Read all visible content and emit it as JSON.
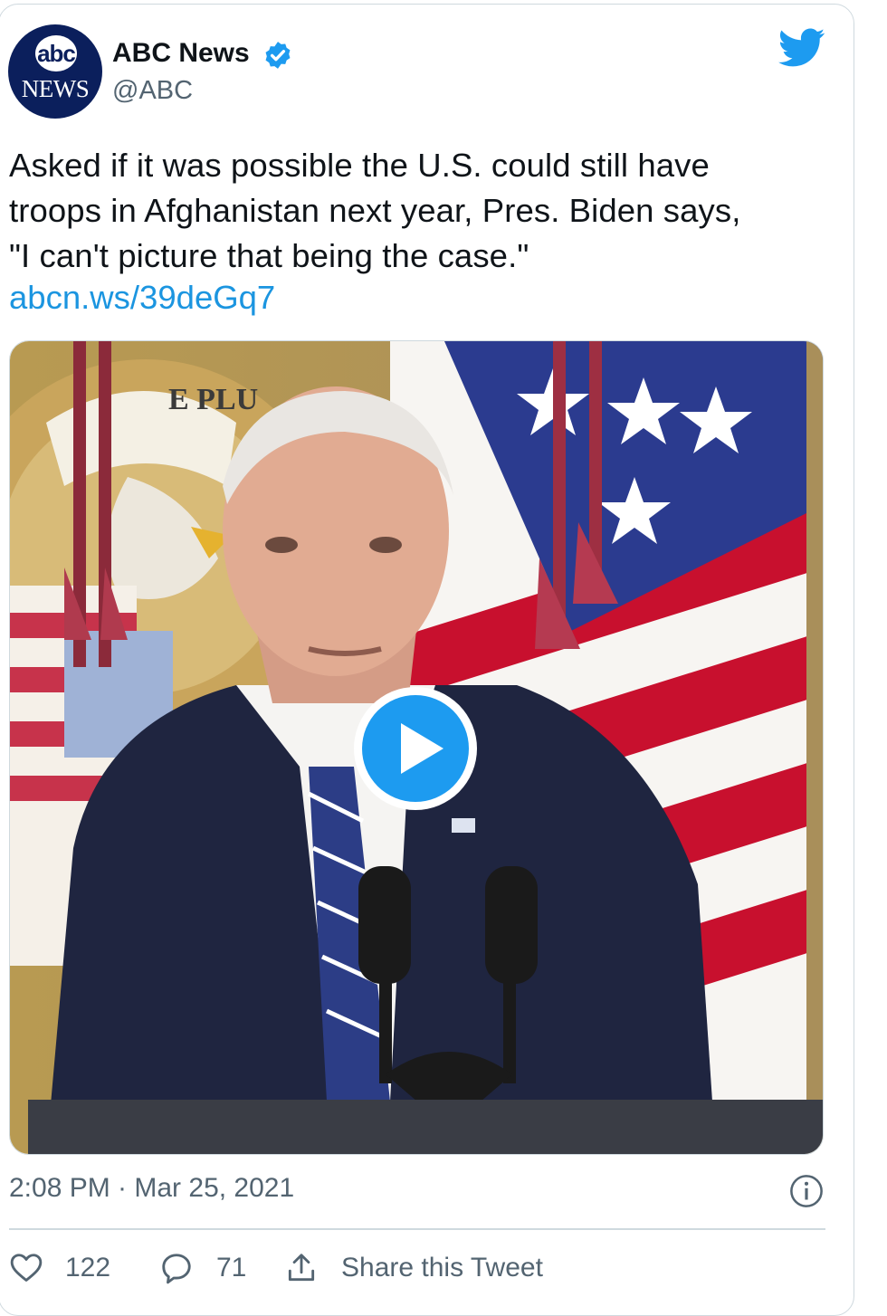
{
  "colors": {
    "accent": "#1d9bf0",
    "link": "#1b95e0",
    "secondary_text": "#536471",
    "border": "#cfd9de"
  },
  "author": {
    "avatar_top": "abc",
    "avatar_bottom": "NEWS",
    "name": "ABC News",
    "handle": "@ABC",
    "verified_icon": "verified-badge-icon"
  },
  "platform_icon": "twitter-bird-icon",
  "tweet": {
    "text_lines": [
      "Asked if it was possible the U.S. could still have",
      "troops in Afghanistan next year, Pres. Biden says,",
      "\"I can't picture that being the case.\""
    ],
    "link": "abcn.ws/39deGq7"
  },
  "media": {
    "type": "video",
    "play_icon": "play-icon",
    "seal_text": "E PLU"
  },
  "meta": {
    "timestamp": "2:08 PM · Mar 25, 2021",
    "info_icon": "info-icon"
  },
  "actions": {
    "like_icon": "heart-icon",
    "like_count": "122",
    "reply_icon": "reply-icon",
    "reply_count": "71",
    "share_icon": "share-icon",
    "share_label": "Share this Tweet"
  }
}
